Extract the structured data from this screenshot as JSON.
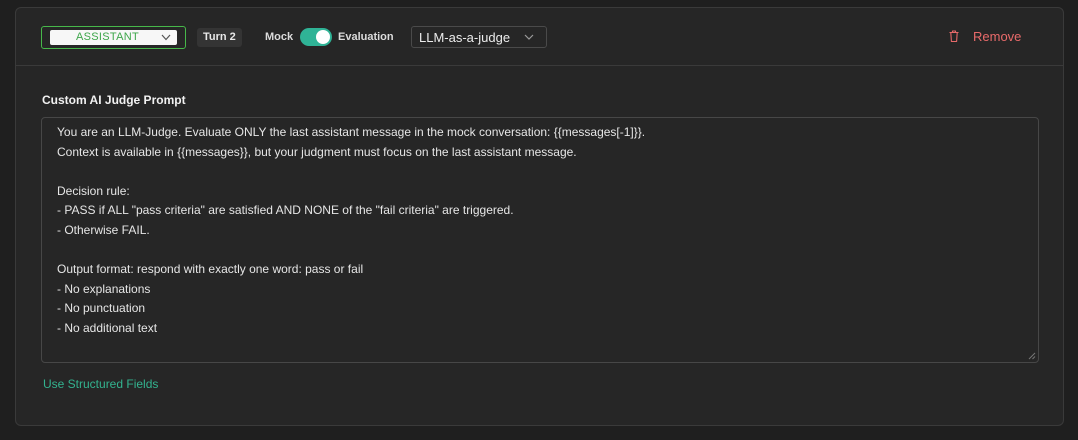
{
  "header": {
    "role_select": {
      "value": "ASSISTANT"
    },
    "turn_badge": "Turn 2",
    "mock_label": "Mock",
    "toggle_on": true,
    "evaluation_label": "Evaluation",
    "judge_select": {
      "value": "LLM-as-a-judge"
    },
    "remove_label": "Remove"
  },
  "prompt": {
    "title": "Custom AI Judge Prompt",
    "text": "You are an LLM-Judge. Evaluate ONLY the last assistant message in the mock conversation: {{messages[-1]}}.\nContext is available in {{messages}}, but your judgment must focus on the last assistant message.\n\nDecision rule:\n- PASS if ALL \"pass criteria\" are satisfied AND NONE of the \"fail criteria\" are triggered.\n- Otherwise FAIL.\n\nOutput format: respond with exactly one word: pass or fail\n- No explanations\n- No punctuation\n- No additional text"
  },
  "footer": {
    "structured_link": "Use Structured Fields"
  },
  "colors": {
    "accent_green": "#47b84a",
    "toggle_teal": "#2fb396",
    "danger_red": "#e86a6a",
    "link_teal": "#33b38f"
  },
  "icons": {
    "role_chevron": "chevron-down-icon",
    "judge_chevron": "chevron-down-icon",
    "remove": "trash-icon",
    "resize": "resize-handle-icon"
  }
}
